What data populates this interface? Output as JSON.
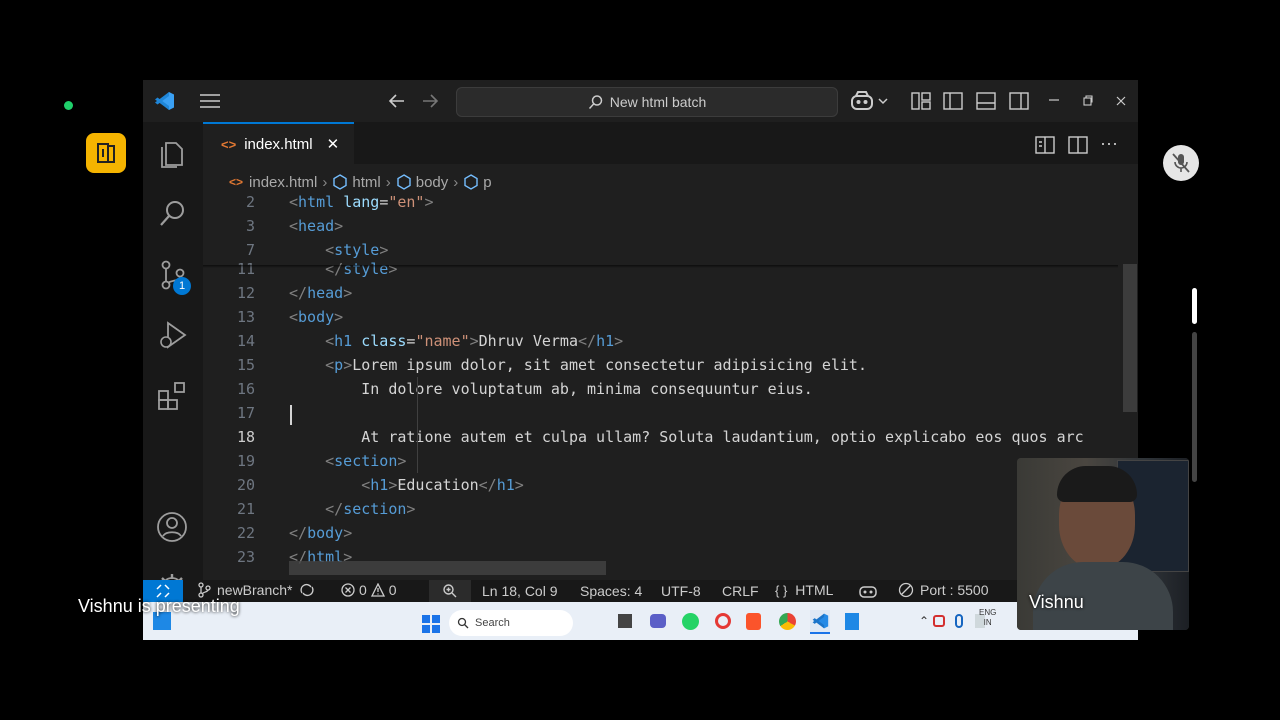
{
  "meeting": {
    "presenter_caption": "Vishnu is presenting",
    "camera_name": "Vishnu"
  },
  "titlebar": {
    "search_text": "New html batch"
  },
  "activity": {
    "scm_badge": "1"
  },
  "tab": {
    "label": "index.html",
    "close": "✕"
  },
  "breadcrumbs": [
    "index.html",
    "html",
    "body",
    "p"
  ],
  "code_lines": [
    {
      "n": "2",
      "html": "<span class=\"t-br\">&lt;</span><span class=\"t-tag\">html</span> <span class=\"t-attr\">lang</span><span class=\"t-txt\">=</span><span class=\"t-str\">\"en\"</span><span class=\"t-br\">&gt;</span>"
    },
    {
      "n": "3",
      "html": "<span class=\"t-br\">&lt;</span><span class=\"t-tag\">head</span><span class=\"t-br\">&gt;</span>"
    },
    {
      "n": "7",
      "html": "    <span class=\"t-br\">&lt;</span><span class=\"t-tag\">style</span><span class=\"t-br\">&gt;</span>"
    },
    {
      "n": "11",
      "html": "    <span class=\"t-br\">&lt;/</span><span class=\"t-tag\">style</span><span class=\"t-br\">&gt;</span>"
    },
    {
      "n": "12",
      "html": "<span class=\"t-br\">&lt;/</span><span class=\"t-tag\">head</span><span class=\"t-br\">&gt;</span>"
    },
    {
      "n": "13",
      "html": "<span class=\"t-br\">&lt;</span><span class=\"t-tag\">body</span><span class=\"t-br\">&gt;</span>"
    },
    {
      "n": "14",
      "html": "    <span class=\"t-br\">&lt;</span><span class=\"t-tag\">h1</span> <span class=\"t-attr\">class</span><span class=\"t-txt\">=</span><span class=\"t-str\">\"name\"</span><span class=\"t-br\">&gt;</span><span class=\"t-txt\">Dhruv Verma</span><span class=\"t-br\">&lt;/</span><span class=\"t-tag\">h1</span><span class=\"t-br\">&gt;</span>"
    },
    {
      "n": "15",
      "html": "    <span class=\"t-br\">&lt;</span><span class=\"t-tag\">p</span><span class=\"t-br\">&gt;</span><span class=\"t-txt\">Lorem ipsum dolor, sit amet consectetur adipisicing elit.</span>"
    },
    {
      "n": "16",
      "html": "        <span class=\"t-txt\">In dolore voluptatum ab, minima consequuntur eius.</span>"
    },
    {
      "n": "17",
      "html": ""
    },
    {
      "n": "18",
      "html": "        <span class=\"t-txt\">At ratione autem et culpa ullam? Soluta laudantium, optio explicabo eos quos arc</span>"
    },
    {
      "n": "19",
      "html": "    <span class=\"t-br\">&lt;</span><span class=\"t-tag\">section</span><span class=\"t-br\">&gt;</span>"
    },
    {
      "n": "20",
      "html": "        <span class=\"t-br\">&lt;</span><span class=\"t-tag\">h1</span><span class=\"t-br\">&gt;</span><span class=\"t-txt\">Education</span><span class=\"t-br\">&lt;/</span><span class=\"t-tag\">h1</span><span class=\"t-br\">&gt;</span>"
    },
    {
      "n": "21",
      "html": "    <span class=\"t-br\">&lt;/</span><span class=\"t-tag\">section</span><span class=\"t-br\">&gt;</span>"
    },
    {
      "n": "22",
      "html": "<span class=\"t-br\">&lt;/</span><span class=\"t-tag\">body</span><span class=\"t-br\">&gt;</span>"
    },
    {
      "n": "23",
      "html": "<span class=\"t-br\">&lt;/</span><span class=\"t-tag\">html</span><span class=\"t-br\">&gt;</span>"
    }
  ],
  "status": {
    "branch": "newBranch*",
    "errors": "0",
    "warnings": "0",
    "position": "Ln 18, Col 9",
    "spaces": "Spaces: 4",
    "encoding": "UTF-8",
    "eol": "CRLF",
    "language": "HTML",
    "port": "Port : 5500"
  },
  "taskbar": {
    "search_label": "Search",
    "lang_line1": "ENG",
    "lang_line2": "IN"
  },
  "colors": {
    "accent": "#0078d4",
    "meet_app": "#f5b400"
  }
}
